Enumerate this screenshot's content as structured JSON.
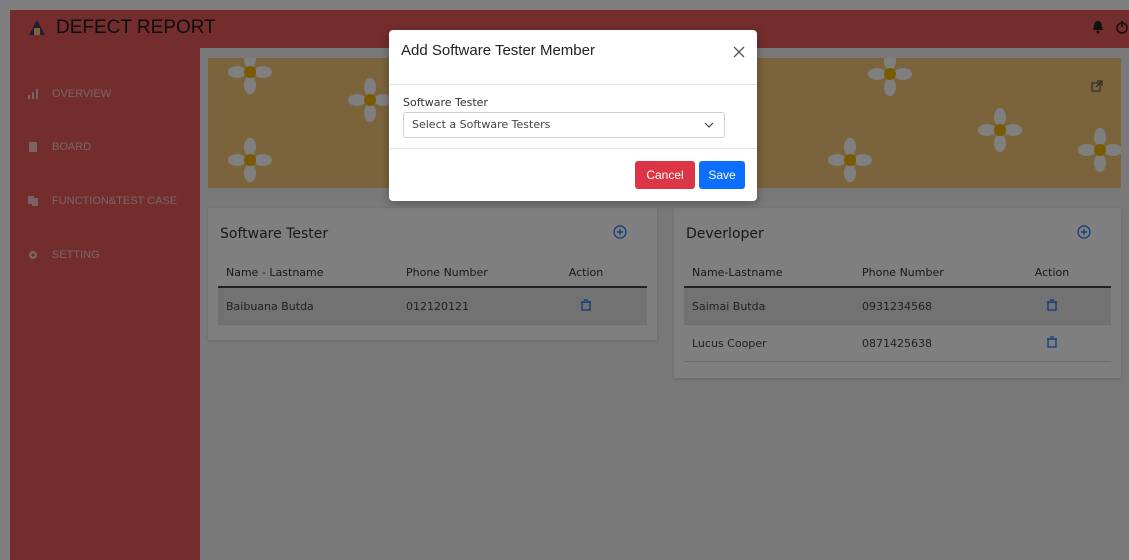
{
  "app": {
    "brand": "DEFECT REPORT"
  },
  "sidebar": {
    "items": [
      {
        "label": "OVERVIEW",
        "icon": "bar-chart-icon"
      },
      {
        "label": "BOARD",
        "icon": "book-icon"
      },
      {
        "label": "FUNCTION&TEST CASE",
        "icon": "copy-icon"
      },
      {
        "label": "SETTING",
        "icon": "gear-icon"
      }
    ]
  },
  "tester_card": {
    "title": "Software Tester",
    "columns": [
      "Name - Lastname",
      "Phone Number",
      "Action"
    ],
    "rows": [
      {
        "name": "Baibuana  Butda",
        "phone": "012120121"
      }
    ]
  },
  "developer_card": {
    "title": "Deverloper",
    "columns": [
      "Name-Lastname",
      "Phone Number",
      "Action"
    ],
    "rows": [
      {
        "name": "Saimai  Butda",
        "phone": "0931234568"
      },
      {
        "name": "Lucus  Cooper",
        "phone": "0871425638"
      }
    ]
  },
  "modal": {
    "title": "Add Software Tester Member",
    "field_label": "Software Tester",
    "select_placeholder": "Select a Software Testers",
    "cancel_label": "Cancel",
    "save_label": "Save"
  },
  "colors": {
    "header_red": "#e85a5a",
    "banner_yellow": "#f6c878",
    "cancel": "#dc3545",
    "save": "#0d6efd"
  }
}
